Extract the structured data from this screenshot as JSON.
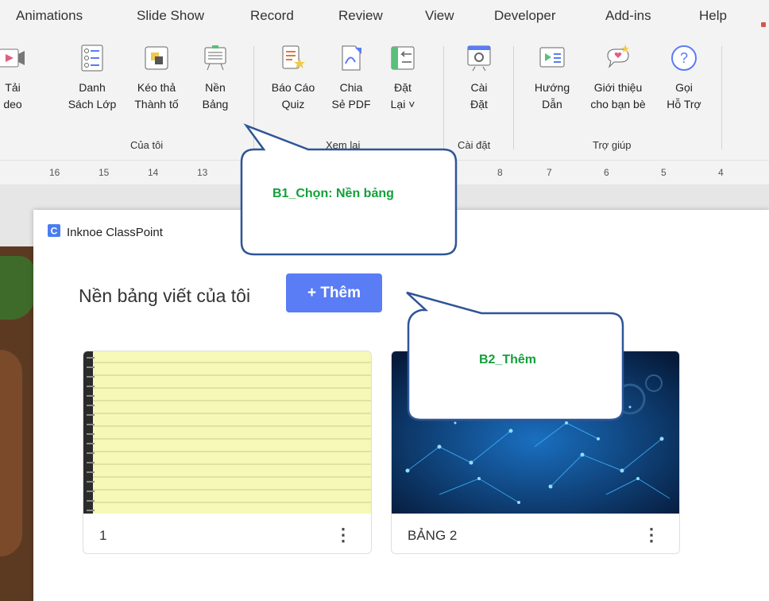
{
  "menubar": {
    "items": [
      "Animations",
      "Slide Show",
      "Record",
      "Review",
      "View",
      "Developer",
      "Add-ins",
      "Help"
    ]
  },
  "ribbon": {
    "partial": {
      "line1": "Tải",
      "line2": "deo"
    },
    "buttons": [
      {
        "line1": "Danh",
        "line2": "Sách Lớp",
        "icon": "student-list-icon"
      },
      {
        "line1": "Kéo thả",
        "line2": "Thành tố",
        "icon": "drag-drop-icon"
      },
      {
        "line1": "Nền",
        "line2": "Bảng",
        "icon": "whiteboard-icon"
      },
      {
        "line1": "Báo Cáo",
        "line2": "Quiz",
        "icon": "quiz-report-icon"
      },
      {
        "line1": "Chia",
        "line2": "Sẻ PDF",
        "icon": "share-pdf-icon"
      },
      {
        "line1": "Đặt",
        "line2": "Lại ˅",
        "icon": "reset-icon"
      },
      {
        "line1": "Cài",
        "line2": "Đặt",
        "icon": "settings-icon"
      },
      {
        "line1": "Hướng",
        "line2": "Dẫn",
        "icon": "tutorial-icon"
      },
      {
        "line1": "Giới thiệu",
        "line2": "cho bạn bè",
        "icon": "refer-friends-icon"
      },
      {
        "line1": "Gọi",
        "line2": "Hỗ Trợ",
        "icon": "help-icon"
      }
    ],
    "groups": [
      "Của tôi",
      "Xem lại",
      "Cài đặt",
      "Trợ giúp"
    ]
  },
  "ruler": {
    "ticks": [
      "16",
      "15",
      "14",
      "13",
      "8",
      "7",
      "6",
      "5",
      "4"
    ]
  },
  "dialog": {
    "title": "Inknoe ClassPoint",
    "heading": "Nền bảng viết của tôi",
    "add_button": "+ Thêm",
    "cards": [
      {
        "name": "1",
        "menu": "⋮"
      },
      {
        "name": "BẢNG 2",
        "menu": "⋮"
      }
    ]
  },
  "callouts": {
    "step1": "B1_Chọn: Nền bảng",
    "step2": "B2_Thêm"
  },
  "colors": {
    "accent": "#5a7cf5",
    "callout_text": "#12a03a",
    "callout_border": "#2f5597"
  }
}
